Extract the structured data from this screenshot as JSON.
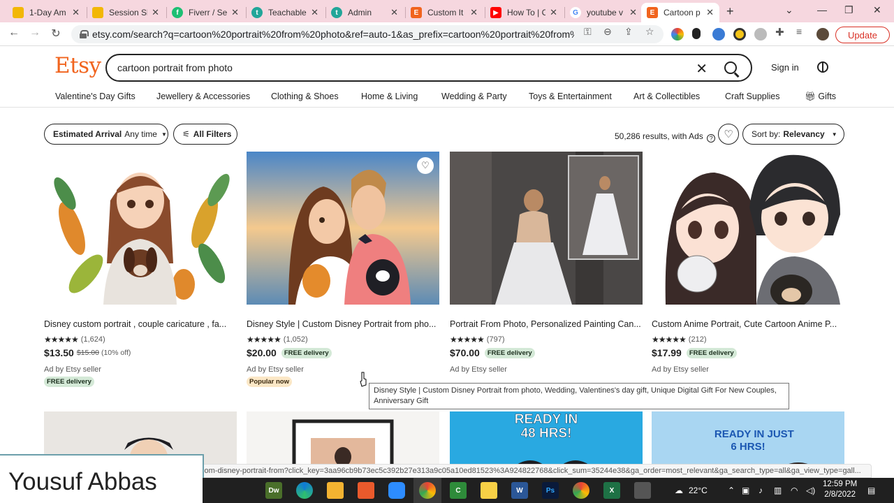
{
  "browser": {
    "tabs": [
      {
        "title": "1-Day Am",
        "color": "#f2b705",
        "glyph": ""
      },
      {
        "title": "Session Sl",
        "color": "#f2b705",
        "glyph": ""
      },
      {
        "title": "Fiverr / Se",
        "color": "#1dbf73",
        "glyph": "fi"
      },
      {
        "title": "Teachable",
        "color": "#22a699",
        "glyph": "t"
      },
      {
        "title": "Admin",
        "color": "#22a699",
        "glyph": "t"
      },
      {
        "title": "Custom It",
        "color": "#f1641e",
        "glyph": "E"
      },
      {
        "title": "How To | C",
        "color": "#ff0000",
        "glyph": "▶"
      },
      {
        "title": "youtube v",
        "color": "#ffffff",
        "glyph": "G"
      },
      {
        "title": "Cartoon p",
        "color": "#f1641e",
        "glyph": "E"
      }
    ],
    "new_tab": "+",
    "url": "etsy.com/search?q=cartoon%20portrait%20from%20photo&ref=auto-1&as_prefix=cartoon%20portrait%20from%20...",
    "update_label": "Update"
  },
  "header": {
    "logo": "Etsy",
    "search_value": "cartoon portrait from photo",
    "signin": "Sign in"
  },
  "categories": [
    "Valentine's Day Gifts",
    "Jewellery & Accessories",
    "Clothing & Shoes",
    "Home & Living",
    "Wedding & Party",
    "Toys & Entertainment",
    "Art & Collectibles",
    "Craft Supplies",
    "Gifts"
  ],
  "filters": {
    "arrival_label": "Estimated Arrival",
    "arrival_value": "Any time",
    "all_filters": "All Filters",
    "results": "50,286 results, with Ads",
    "sort_label": "Sort by:",
    "sort_value": "Relevancy"
  },
  "products": [
    {
      "title": "Disney custom portrait , couple caricature , fa...",
      "stars": "★★★★★",
      "reviews": "(1,624)",
      "price": "$13.50",
      "original": "$15.00",
      "discount": "(10% off)",
      "free_delivery_inline": "",
      "ad": "Ad by Etsy seller",
      "badge": "FREE delivery",
      "badge_color": "#d4e9d7"
    },
    {
      "title": "Disney Style | Custom Disney Portrait from pho...",
      "stars": "★★★★★",
      "reviews": "(1,052)",
      "price": "$20.00",
      "original": "",
      "discount": "",
      "free_delivery_inline": "FREE delivery",
      "ad": "Ad by Etsy seller",
      "badge": "Popular now",
      "badge_color": "#fbe7c6"
    },
    {
      "title": "Portrait From Photo, Personalized Painting Can...",
      "stars": "★★★★★",
      "reviews": "(797)",
      "price": "$70.00",
      "original": "",
      "discount": "",
      "free_delivery_inline": "FREE delivery",
      "ad": "Ad by Etsy seller",
      "badge": "",
      "badge_color": ""
    },
    {
      "title": "Custom Anime Portrait, Cute Cartoon Anime P...",
      "stars": "★★★★★",
      "reviews": "(212)",
      "price": "$17.99",
      "original": "",
      "discount": "",
      "free_delivery_inline": "FREE delivery",
      "ad": "Ad by Etsy seller",
      "badge": "",
      "badge_color": ""
    }
  ],
  "row2_banners": {
    "third": "READY IN\n48 HRS!",
    "fourth": "READY IN JUST\n6 HRS!"
  },
  "tooltip": "Disney Style | Custom Disney Portrait from photo, Wedding, Valentines's day gift, Unique Digital Gift For New Couples, Anniversary Gift",
  "status_url": "com-disney-portrait-from?click_key=3aa96cb9b73ec5c392b27e313a9c05a10ed81523%3A924822768&click_sum=35244e38&ga_order=most_relevant&ga_search_type=all&ga_view_type=gall...",
  "overlay_name": "Yousuf Abbas",
  "taskbar": {
    "temperature": "22°C",
    "time": "12:59 PM",
    "date": "2/8/2022"
  }
}
